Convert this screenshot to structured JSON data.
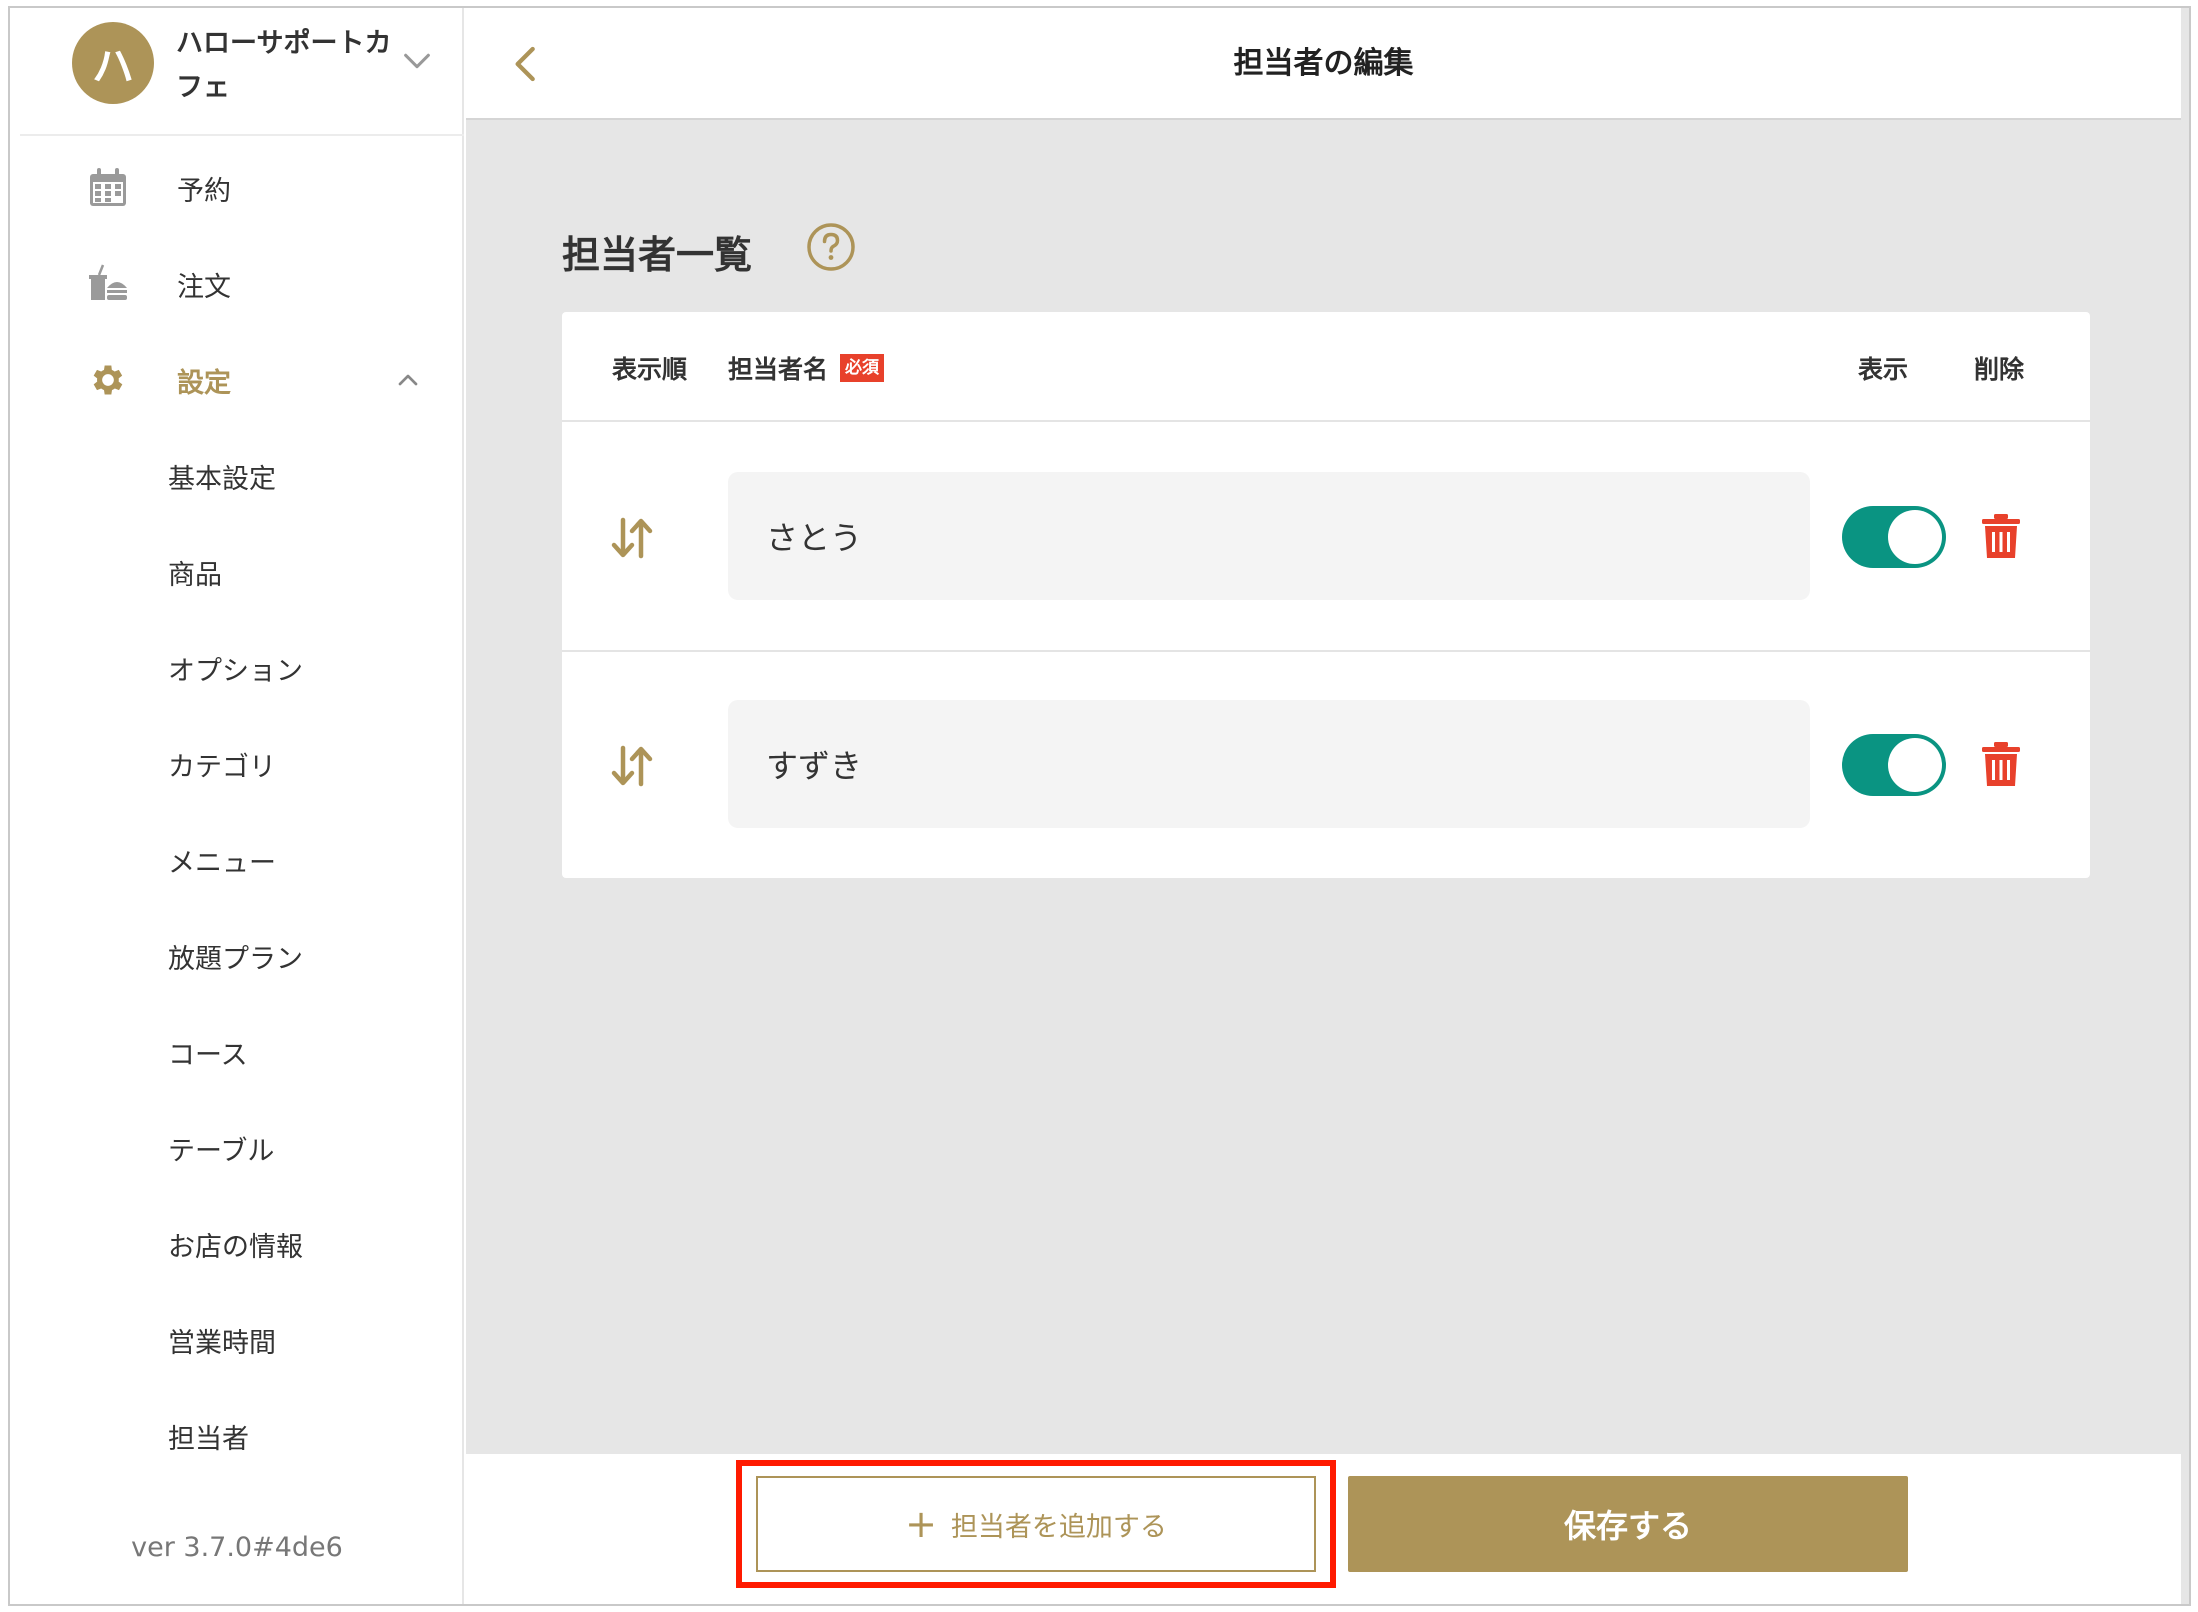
{
  "store": {
    "avatar_initial": "ハ",
    "name": "ハローサポートカフェ"
  },
  "nav": {
    "reservation": "予約",
    "order": "注文",
    "settings": "設定",
    "sub_items": [
      "基本設定",
      "商品",
      "オプション",
      "カテゴリ",
      "メニュー",
      "放題プラン",
      "コース",
      "テーブル",
      "お店の情報",
      "営業時間",
      "担当者"
    ]
  },
  "version": "ver 3.7.0#4de6",
  "header": {
    "title": "担当者の編集"
  },
  "section": {
    "title": "担当者一覧"
  },
  "table": {
    "col_order": "表示順",
    "col_name": "担当者名",
    "required": "必須",
    "col_display": "表示",
    "col_delete": "削除",
    "rows": [
      {
        "name": "さとう",
        "display": true
      },
      {
        "name": "すずき",
        "display": true
      }
    ]
  },
  "footer": {
    "add_label": "担当者を追加する",
    "add_symbol": "+",
    "save_label": "保存する"
  },
  "colors": {
    "accent": "#ad9458",
    "toggle_on": "#0a9482",
    "danger": "#e8412b",
    "highlight": "#ff1a00"
  }
}
